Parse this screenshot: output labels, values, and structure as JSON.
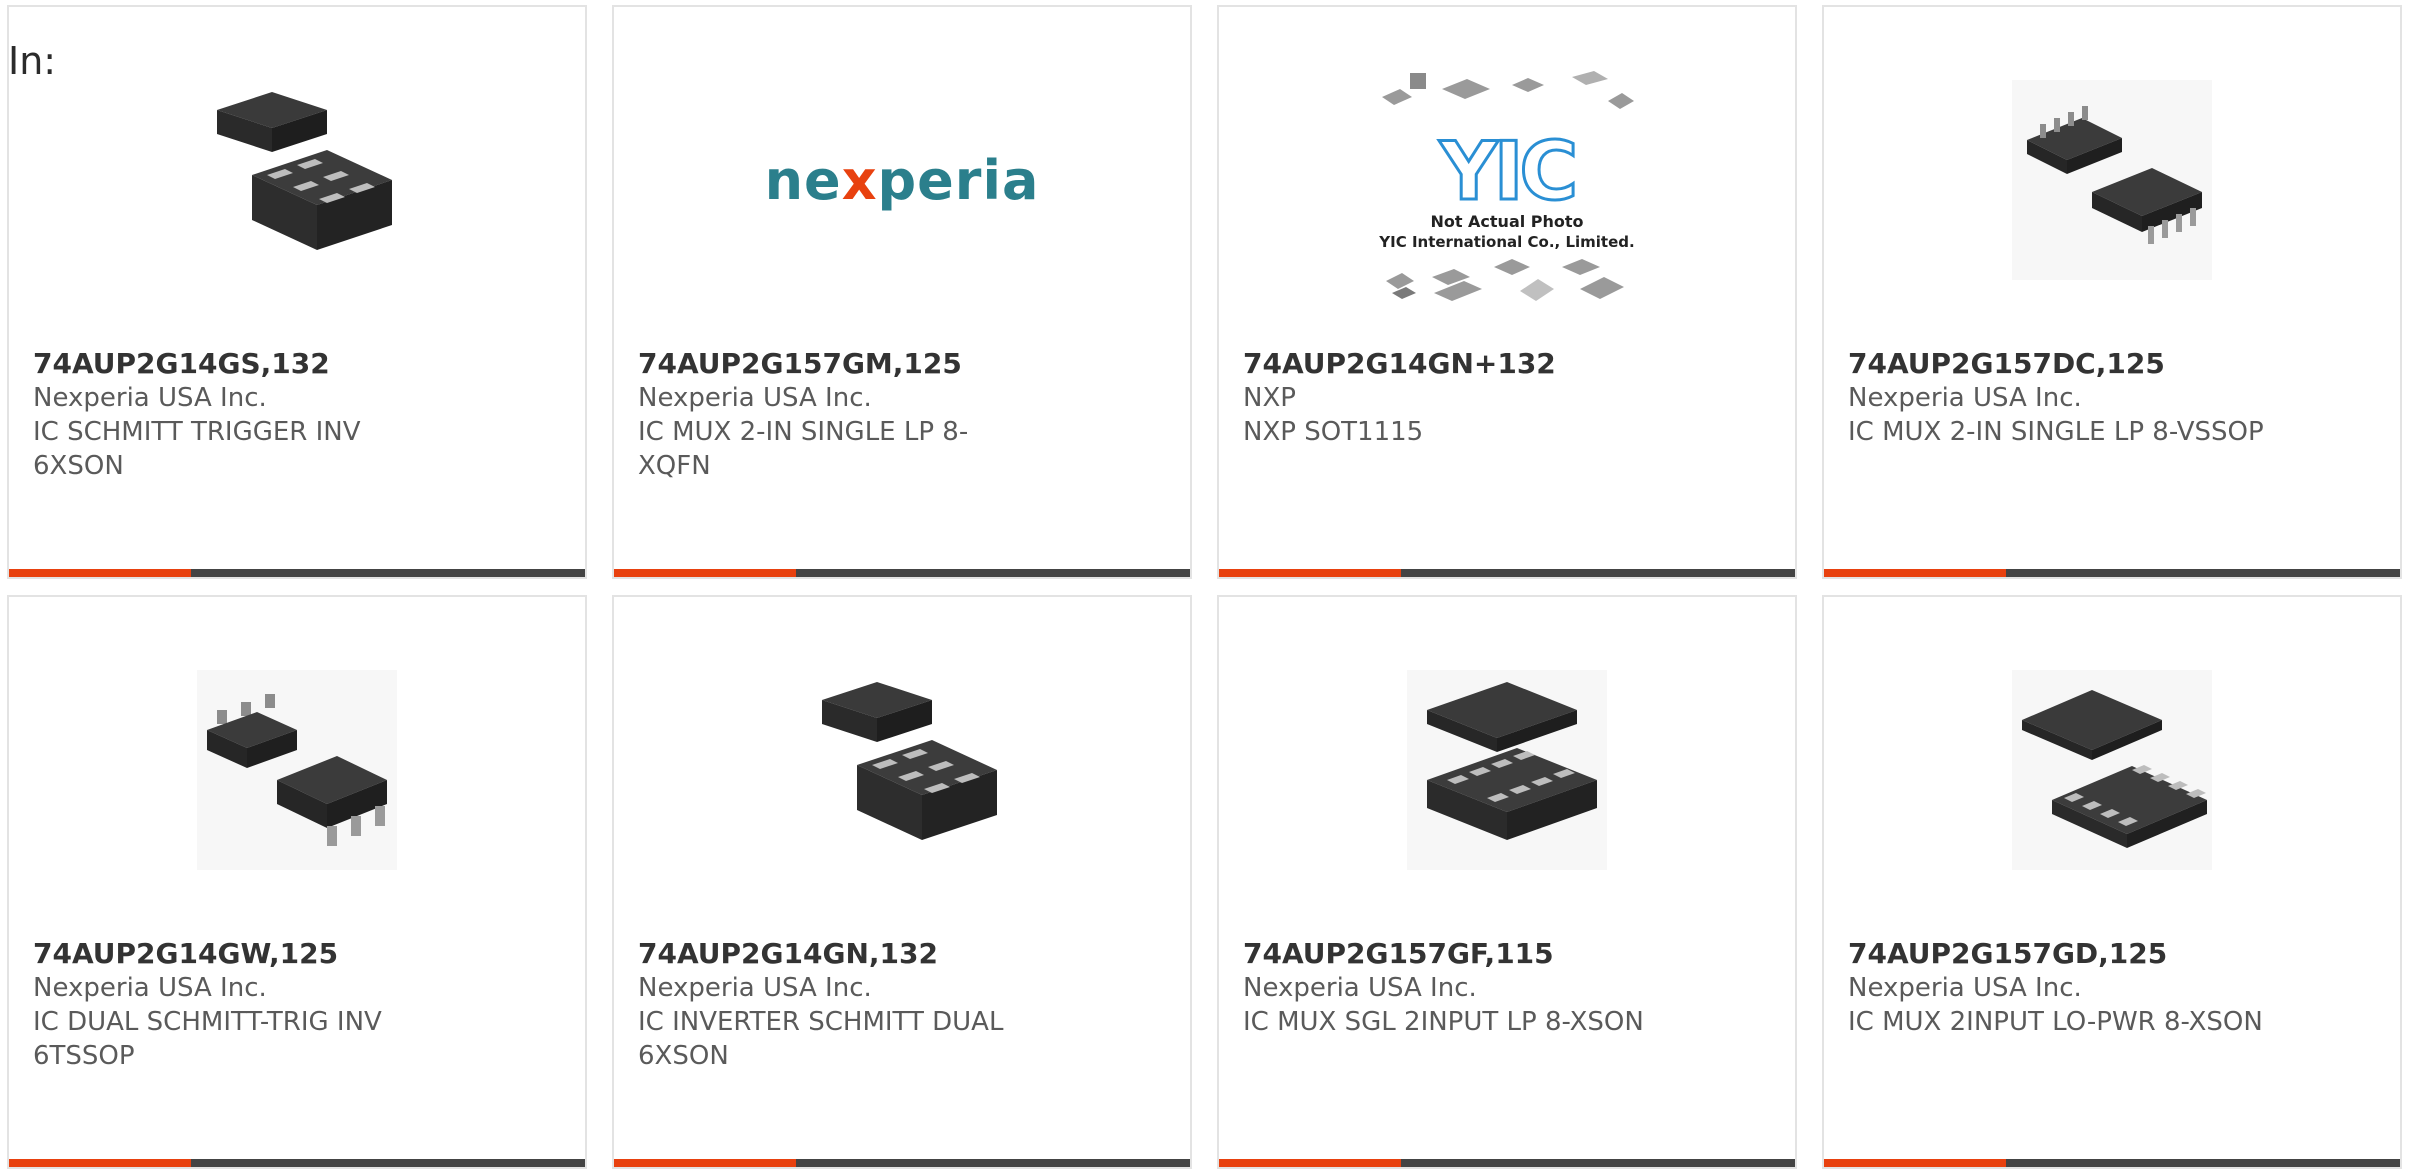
{
  "heading": "In:",
  "colors": {
    "accent": "#e8410f",
    "bar": "#444444",
    "card_border": "#e3e3e3",
    "nexperia_teal": "#2b7f8c"
  },
  "cards": [
    {
      "part": "74AUP2G14GS,132",
      "manufacturer": "Nexperia USA Inc.",
      "description": "IC SCHMITT TRIGGER INV 6XSON",
      "image": "chip-xson6-icon"
    },
    {
      "part": "74AUP2G157GM,125",
      "manufacturer": "Nexperia USA Inc.",
      "description": "IC MUX 2-IN SINGLE LP 8-XQFN",
      "image": "nexperia-logo",
      "logo_text_a": "ne",
      "logo_text_x": "x",
      "logo_text_b": "peria"
    },
    {
      "part": "74AUP2G14GN+132",
      "manufacturer": "NXP",
      "description": "NXP SOT1115",
      "image": "yic-placeholder",
      "logo_text": "YIC",
      "caption1": "Not Actual Photo",
      "caption2": "YIC International Co., Limited."
    },
    {
      "part": "74AUP2G157DC,125",
      "manufacturer": "Nexperia USA Inc.",
      "description": "IC MUX 2-IN SINGLE LP 8-VSSOP",
      "image": "chip-vssop8-icon"
    },
    {
      "part": "74AUP2G14GW,125",
      "manufacturer": "Nexperia USA Inc.",
      "description": "IC DUAL SCHMITT-TRIG INV 6TSSOP",
      "image": "chip-tssop6-icon"
    },
    {
      "part": "74AUP2G14GN,132",
      "manufacturer": "Nexperia USA Inc.",
      "description": "IC INVERTER SCHMITT DUAL 6XSON",
      "image": "chip-xson6-icon"
    },
    {
      "part": "74AUP2G157GF,115",
      "manufacturer": "Nexperia USA Inc.",
      "description": "IC MUX SGL 2INPUT LP 8-XSON",
      "image": "chip-xson8-icon"
    },
    {
      "part": "74AUP2G157GD,125",
      "manufacturer": "Nexperia USA Inc.",
      "description": "IC MUX 2INPUT LO-PWR 8-XSON",
      "image": "chip-xson8b-icon"
    }
  ]
}
